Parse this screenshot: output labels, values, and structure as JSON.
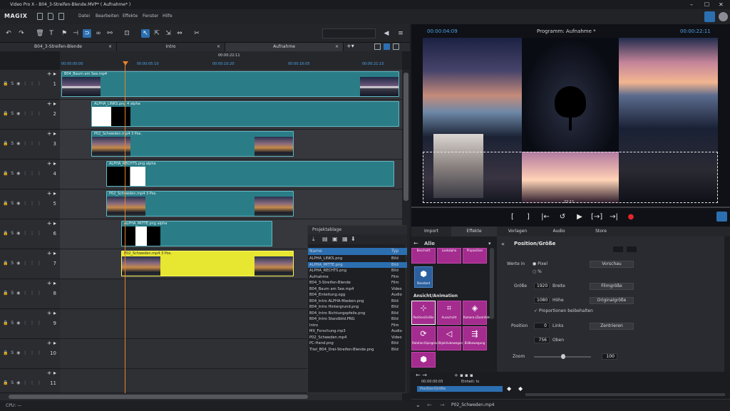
{
  "window": {
    "title": "Video Pro X - B04_3-Streifen-Blende.MVP* ( Aufnahme* )"
  },
  "menu": {
    "logo": "MAGIX",
    "items": [
      "Datei",
      "Bearbeiten",
      "Effekte",
      "Fenster",
      "Hilfe"
    ]
  },
  "tabs": [
    "B04_3-Streifen-Blende",
    "Intro",
    "Aufnahme"
  ],
  "ruler": {
    "current": "00:00:22:11",
    "marks": [
      "00:00:00:00",
      "00:00:05:10",
      "00:00:10:20",
      "00:00:16:05",
      "00:00:21:15"
    ]
  },
  "tracks": [
    {
      "num": "1",
      "clips": [
        {
          "label": "B04_Baum am See.mp4"
        }
      ]
    },
    {
      "num": "2",
      "clips": [
        {
          "label": "ALPHA_LINKS.png 4 alpha"
        }
      ]
    },
    {
      "num": "3",
      "clips": [
        {
          "label": "P02_Schweden.mp4 3 Pos."
        }
      ]
    },
    {
      "num": "4",
      "clips": [
        {
          "label": "ALPHA_RECHTS.png alpha"
        }
      ]
    },
    {
      "num": "5",
      "clips": [
        {
          "label": "P02_Schweden.mp4 3 Pos."
        }
      ]
    },
    {
      "num": "6",
      "clips": [
        {
          "label": "ALPHA_MITTE.png alpha"
        }
      ]
    },
    {
      "num": "7",
      "clips": [
        {
          "label": "P02_Schweden.mp4 3 Pos."
        }
      ]
    },
    {
      "num": "8"
    },
    {
      "num": "9"
    },
    {
      "num": "10"
    },
    {
      "num": "11"
    }
  ],
  "status": {
    "text": "CPU: —"
  },
  "preview": {
    "timecode_left": "00:00:04:09",
    "title": "Programm: Aufnahme *",
    "timecode_right": "00:00:22:11",
    "bar_time": "22:11"
  },
  "transport": {
    "buttons": [
      "[",
      "]",
      "|←",
      "↺",
      "▶",
      "[→]",
      "→|",
      "●"
    ]
  },
  "right_tabs": [
    "Import",
    "Effekte",
    "Vorlagen",
    "Audio",
    "Store"
  ],
  "effects": {
    "category": "Alle",
    "section": "Ansicht/Animation",
    "top_items": [
      "Beschnitt",
      "Lookalpha",
      "Proposition"
    ],
    "standard": "Standard",
    "items": [
      "Position/Größe",
      "Ausschnitt",
      "Kamera-/Zoomfahrt",
      "Rotation/Spiegelung",
      "Objektivbewegung",
      "Bildbewegung"
    ]
  },
  "properties": {
    "title": "Position/Größe",
    "werte_in": "Werte in",
    "pixel": "Pixel",
    "percent": "%",
    "vorschau": "Vorschau",
    "groesse": "Größe",
    "breite_val": "1920",
    "breite": "Breite",
    "filmgroesse": "Filmgröße",
    "hoehe_val": "1080",
    "hoehe": "Höhe",
    "originalgroesse": "Originalgröße",
    "proportionen": "Proportionen beibehalten",
    "position": "Position",
    "links_val": "0",
    "links": "Links",
    "zentrieren": "Zentrieren",
    "oben_val": "756",
    "oben": "Oben",
    "zoom": "Zoom",
    "zoom_val": "100"
  },
  "keyframes": {
    "time": "00:00:00:05",
    "label": "Einheit: ts",
    "track_label": "Position/Größe",
    "clip": "P02_Schweden.mp4"
  },
  "projbin": {
    "title": "Projektablage",
    "col_name": "Name",
    "col_type": "Typ",
    "rows": [
      {
        "name": "ALPHA_LINKS.png",
        "type": "Bild"
      },
      {
        "name": "ALPHA_MITTE.png",
        "type": "Bild",
        "selected": true
      },
      {
        "name": "ALPHA_RECHTS.png",
        "type": "Bild"
      },
      {
        "name": "Aufnahme",
        "type": "Film"
      },
      {
        "name": "B04_3-Streifen-Blende",
        "type": "Film"
      },
      {
        "name": "B04_Baum am See.mp4",
        "type": "Video"
      },
      {
        "name": "B04_Einleitung.ogg",
        "type": "Audio"
      },
      {
        "name": "B04_Intro ALPHA-Masken.png",
        "type": "Bild"
      },
      {
        "name": "B04_Intro Hintergrund.png",
        "type": "Bild"
      },
      {
        "name": "B04_Intro Richtungspfeile.png",
        "type": "Bild"
      },
      {
        "name": "B04_Intro Standbild.PNG",
        "type": "Bild"
      },
      {
        "name": "Intro",
        "type": "Film"
      },
      {
        "name": "MX_Forschung.mp3",
        "type": "Audio"
      },
      {
        "name": "P02_Schweden.mp4",
        "type": "Video"
      },
      {
        "name": "PC-Hand.png",
        "type": "Bild"
      },
      {
        "name": "Titel_B04_Drei-Streifen-Blende.png",
        "type": "Bild"
      }
    ]
  },
  "colors": {
    "accent": "#2c6fb1",
    "clip": "#2a7d86",
    "clip_yellow": "#e7e631",
    "effect_tile": "#a42c8f",
    "playhead": "#e8822a"
  }
}
